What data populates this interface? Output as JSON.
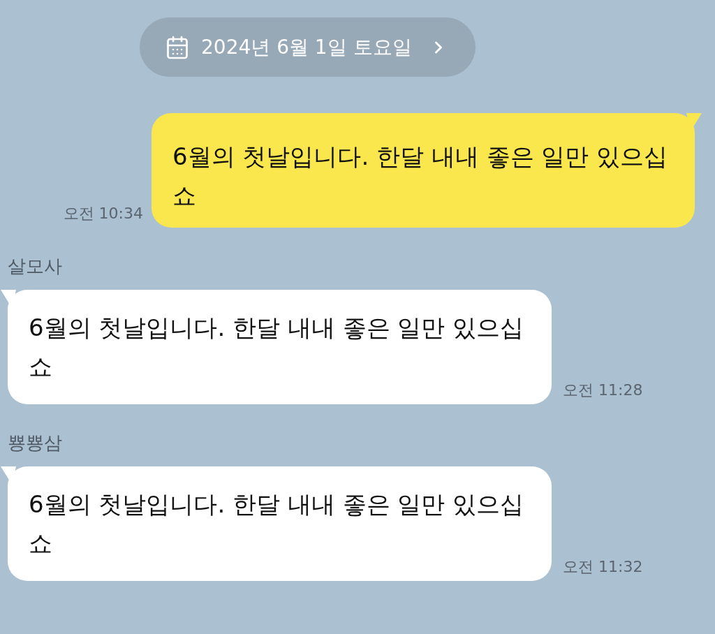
{
  "date_divider": {
    "label": "2024년 6월 1일 토요일"
  },
  "messages": [
    {
      "kind": "sent",
      "text": "6월의 첫날입니다. 한달 내내 좋은 일만 있으십쇼",
      "time": "오전 10:34"
    },
    {
      "kind": "received",
      "sender": "살모사",
      "text": "6월의 첫날입니다. 한달 내내 좋은 일만 있으십쇼",
      "time": "오전 11:28"
    },
    {
      "kind": "received",
      "sender": "뿅뿅삼",
      "text": "6월의 첫날입니다. 한달 내내 좋은 일만 있으십쇼",
      "time": "오전 11:32"
    }
  ]
}
